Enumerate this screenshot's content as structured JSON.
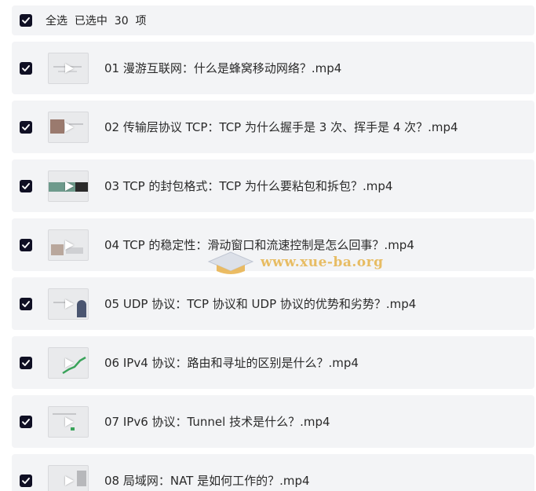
{
  "header": {
    "select_all_label": "全选  已选中  30  项"
  },
  "items": [
    {
      "title": "01  漫游互联网：什么是蜂窝移动网络？.mp4",
      "checked": true
    },
    {
      "title": "02  传输层协议 TCP：TCP 为什么握手是 3 次、挥手是 4 次？.mp4",
      "checked": true
    },
    {
      "title": "03  TCP 的封包格式：TCP 为什么要粘包和拆包？.mp4",
      "checked": true
    },
    {
      "title": "04  TCP 的稳定性：滑动窗口和流速控制是怎么回事？.mp4",
      "checked": true
    },
    {
      "title": "05  UDP 协议：TCP 协议和 UDP 协议的优势和劣势？.mp4",
      "checked": true
    },
    {
      "title": "06  IPv4 协议：路由和寻址的区别是什么？.mp4",
      "checked": true
    },
    {
      "title": "07  IPv6 协议：Tunnel 技术是什么？.mp4",
      "checked": true
    },
    {
      "title": "08  局域网：NAT 是如何工作的？.mp4",
      "checked": true
    }
  ],
  "watermark": {
    "text": "www.xue-ba.org"
  },
  "colors": {
    "checkbox": "#101024",
    "row_bg": "#f3f4f6",
    "watermark": "#e6b34a"
  }
}
